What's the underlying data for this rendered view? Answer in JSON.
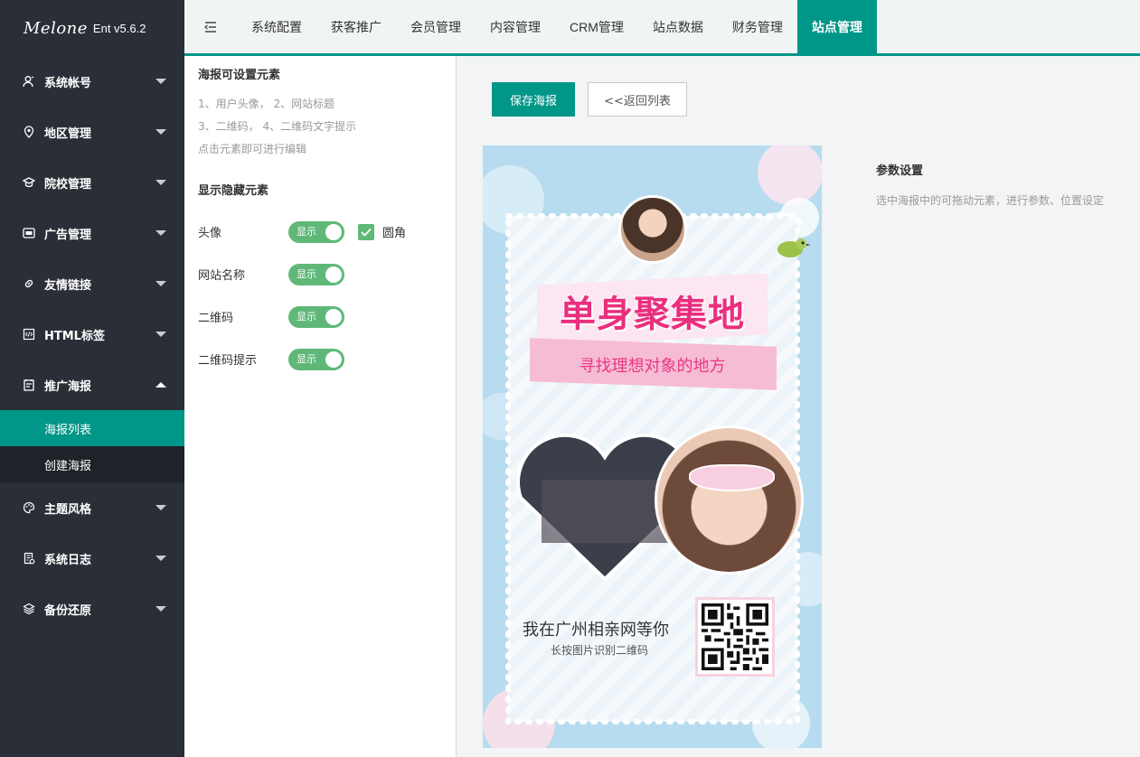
{
  "app": {
    "logo_script": "Melone",
    "version": "Ent v5.6.2"
  },
  "sidebar": {
    "items": [
      {
        "label": "系统帐号",
        "icon": "user-icon"
      },
      {
        "label": "地区管理",
        "icon": "location-icon"
      },
      {
        "label": "院校管理",
        "icon": "school-icon"
      },
      {
        "label": "广告管理",
        "icon": "ad-icon"
      },
      {
        "label": "友情链接",
        "icon": "link-icon"
      },
      {
        "label": "HTML标签",
        "icon": "code-icon"
      },
      {
        "label": "推广海报",
        "icon": "poster-icon",
        "expanded": true,
        "children": [
          {
            "label": "海报列表",
            "active": true
          },
          {
            "label": "创建海报"
          }
        ]
      },
      {
        "label": "主题风格",
        "icon": "palette-icon"
      },
      {
        "label": "系统日志",
        "icon": "log-icon"
      },
      {
        "label": "备份还原",
        "icon": "layers-icon"
      }
    ]
  },
  "topnav": {
    "tabs": [
      "系统配置",
      "获客推广",
      "会员管理",
      "内容管理",
      "CRM管理",
      "站点数据",
      "财务管理",
      "站点管理"
    ],
    "active_index": 7
  },
  "config": {
    "section1_title": "海报可设置元素",
    "hint_lines": [
      "1、用户头像， 2、网站标题",
      "3、二维码， 4、二维码文字提示",
      "点击元素即可进行编辑"
    ],
    "section2_title": "显示隐藏元素",
    "toggles": [
      {
        "label": "头像",
        "switch_text": "显示",
        "on": true,
        "checkbox": {
          "label": "圆角",
          "checked": true
        }
      },
      {
        "label": "网站名称",
        "switch_text": "显示",
        "on": true
      },
      {
        "label": "二维码",
        "switch_text": "显示",
        "on": true
      },
      {
        "label": "二维码提示",
        "switch_text": "显示",
        "on": true
      }
    ]
  },
  "workspace": {
    "save_label": "保存海报",
    "back_label": "<<返回列表",
    "params_title": "参数设置",
    "params_hint": "选中海报中的可拖动元素，进行参数、位置设定"
  },
  "poster": {
    "title": "单身聚集地",
    "subtitle": "寻找理想对象的地方",
    "site_text": "我在广州相亲网等你",
    "qr_hint": "长按图片识别二维码",
    "colors": {
      "accent": "#009688",
      "title": "#ea2f7e",
      "bg": "#b7dcef"
    }
  }
}
